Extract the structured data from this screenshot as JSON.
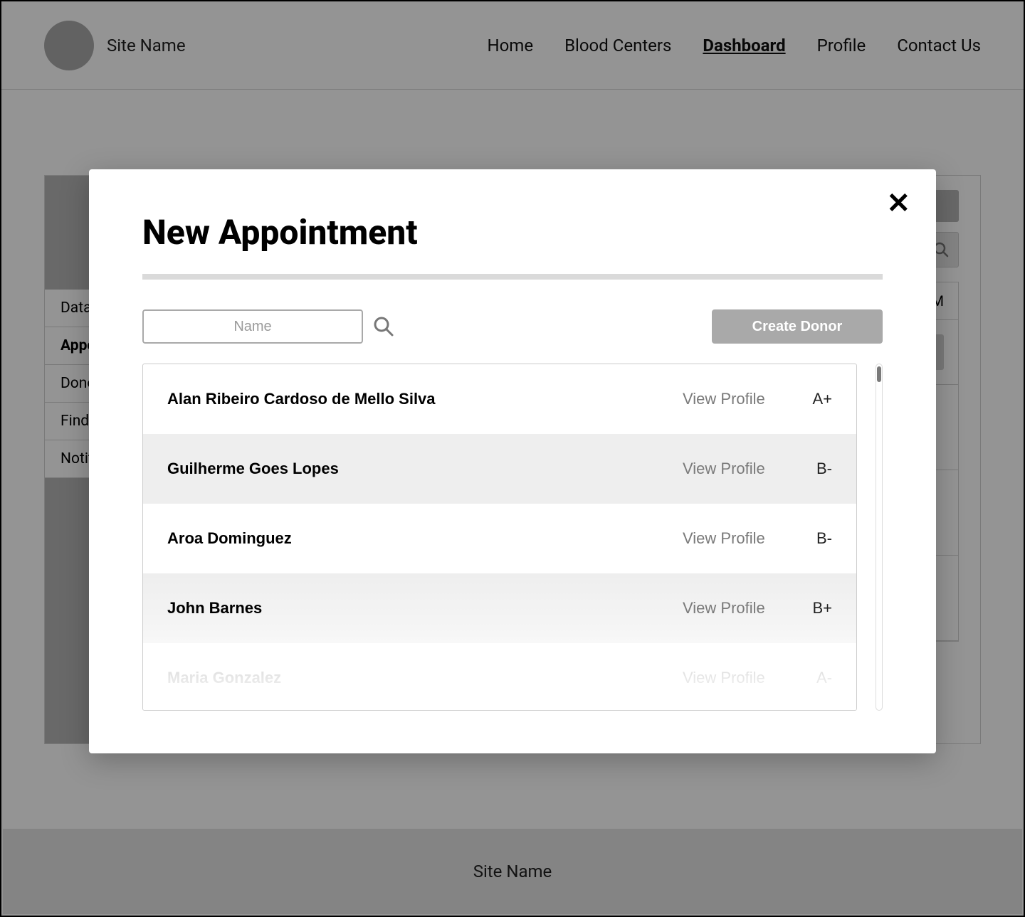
{
  "header": {
    "site_name": "Site Name",
    "nav": {
      "home": "Home",
      "blood_centers": "Blood Centers",
      "dashboard": "Dashboard",
      "profile": "Profile",
      "contact": "Contact Us"
    }
  },
  "sidebar": {
    "items": [
      {
        "label": "Data"
      },
      {
        "label": "Appointments"
      },
      {
        "label": "Donors"
      },
      {
        "label": "Find Donors"
      },
      {
        "label": "Notifications"
      }
    ]
  },
  "content": {
    "header_time_suffix": "M"
  },
  "modal": {
    "title": "New Appointment",
    "name_placeholder": "Name",
    "create_donor_label": "Create Donor",
    "view_profile_label": "View Profile",
    "donors": [
      {
        "name": "Alan Ribeiro Cardoso de Mello Silva",
        "blood_type": "A+"
      },
      {
        "name": "Guilherme Goes Lopes",
        "blood_type": "B-"
      },
      {
        "name": "Aroa Dominguez",
        "blood_type": "B-"
      },
      {
        "name": "John Barnes",
        "blood_type": "B+"
      },
      {
        "name": "Maria Gonzalez",
        "blood_type": "A-"
      }
    ]
  },
  "footer": {
    "site_name": "Site Name"
  }
}
